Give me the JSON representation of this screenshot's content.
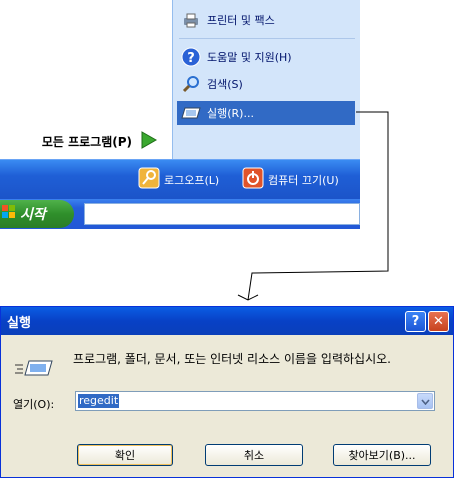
{
  "start_menu": {
    "items": [
      {
        "label": "프린터 및 팩스",
        "icon": "printer-fax-icon"
      },
      {
        "label": "도움말 및 지원(H)",
        "icon": "help-icon"
      },
      {
        "label": "검색(S)",
        "icon": "search-icon"
      },
      {
        "label": "실행(R)...",
        "icon": "run-icon",
        "selected": true
      }
    ],
    "all_programs": "모든 프로그램(P)",
    "logoff": "로그오프(L)",
    "shutdown": "컴퓨터 끄기(U)",
    "start_label": "시작"
  },
  "dialog": {
    "title": "실행",
    "help_glyph": "?",
    "close_glyph": "✕",
    "description": "프로그램, 폴더, 문서, 또는 인터넷 리소스 이름을 입력하십시오.",
    "open_label": "열기(O):",
    "open_value": "regedit",
    "ok": "확인",
    "cancel": "취소",
    "browse": "찾아보기(B)..."
  },
  "colors": {
    "selection": "#316ac5",
    "title_bar": "#0a5de4",
    "dialog_bg": "#ece9d8",
    "start_green": "#2f8f2b"
  }
}
